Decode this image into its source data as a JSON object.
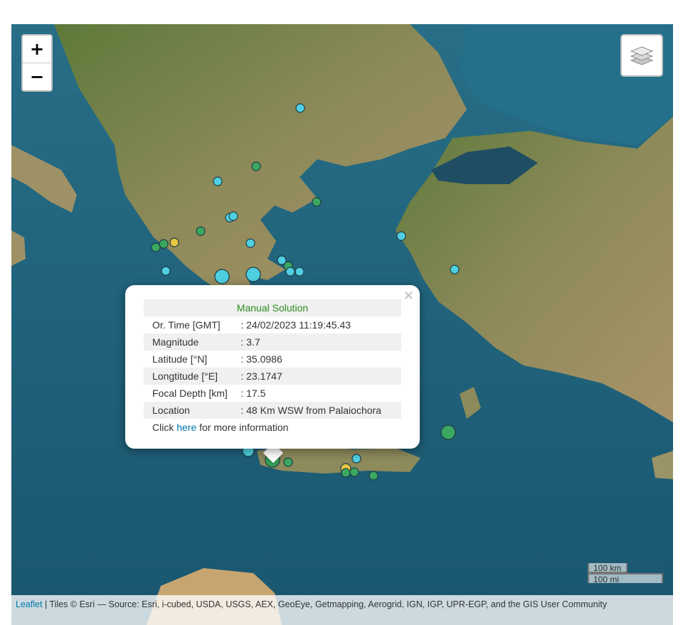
{
  "controls": {
    "zoom_in": "+",
    "zoom_out": "−",
    "layers_icon": "layers-icon"
  },
  "popup": {
    "title": "Manual Solution",
    "close": "×",
    "rows": [
      {
        "label": "Or. Time [GMT]",
        "value": ": 24/02/2023 11:19:45.43"
      },
      {
        "label": "Magnitude",
        "value": ": 3.7"
      },
      {
        "label": "Latitude [°N]",
        "value": ": 35.0986"
      },
      {
        "label": "Longtitude [°E]",
        "value": ": 23.1747"
      },
      {
        "label": "Focal Depth [km]",
        "value": ": 17.5"
      },
      {
        "label": "Location",
        "value": ": 48 Km WSW from Palaiochora"
      }
    ],
    "footer_before": "Click ",
    "footer_link": "here",
    "footer_after": " for more information"
  },
  "scale": {
    "km": "100 km",
    "mi": "100 mi"
  },
  "attribution": {
    "leaflet": "Leaflet",
    "text": " | Tiles © Esri — Source: Esri, i-cubed, USDA, USGS, AEX, GeoEye, Getmapping, Aerogrid, IGN, IGP, UPR-EGP, and the GIS User Community"
  },
  "colors": {
    "sea": "#1f5f78",
    "land": "#8a8a58",
    "marker_cyan": "#4fd0e2",
    "marker_green": "#3aa860",
    "marker_yellow": "#e8c840"
  }
}
